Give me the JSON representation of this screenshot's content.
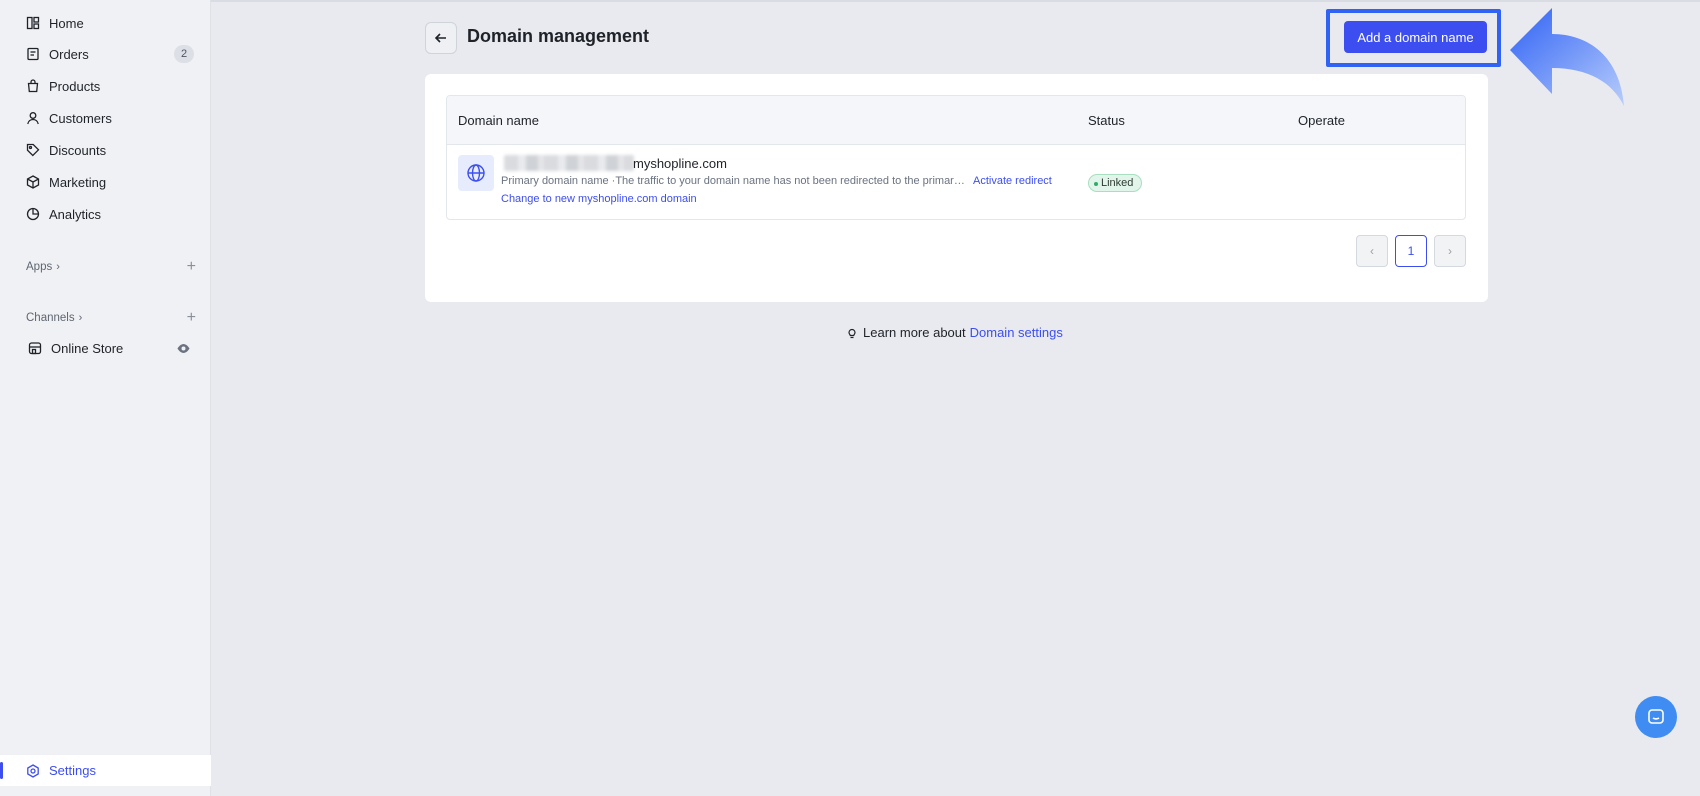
{
  "sidebar": {
    "items": [
      {
        "label": "Home",
        "icon": "home-icon"
      },
      {
        "label": "Orders",
        "icon": "orders-icon",
        "badge": "2"
      },
      {
        "label": "Products",
        "icon": "products-icon"
      },
      {
        "label": "Customers",
        "icon": "customers-icon"
      },
      {
        "label": "Discounts",
        "icon": "discounts-icon"
      },
      {
        "label": "Marketing",
        "icon": "marketing-icon"
      },
      {
        "label": "Analytics",
        "icon": "analytics-icon"
      }
    ],
    "apps_label": "Apps",
    "channels_label": "Channels",
    "online_store_label": "Online Store",
    "settings_label": "Settings"
  },
  "header": {
    "title": "Domain management",
    "add_button_label": "Add a domain name"
  },
  "table": {
    "columns": [
      "Domain name",
      "Status",
      "Operate"
    ],
    "rows": [
      {
        "domain_suffix": "myshopline.com",
        "description": "Primary domain name ·The traffic to your domain name has not been redirected to the primary domain name",
        "activate_link": "Activate redirect",
        "change_link": "Change to new myshopline.com domain",
        "status": "Linked"
      }
    ]
  },
  "pagination": {
    "current_page": "1"
  },
  "footer": {
    "learn_prefix": "Learn more about",
    "learn_link": "Domain settings"
  },
  "colors": {
    "accent": "#3d4ef0",
    "highlight": "#2f62f5",
    "status_green": "#2eae6a"
  }
}
